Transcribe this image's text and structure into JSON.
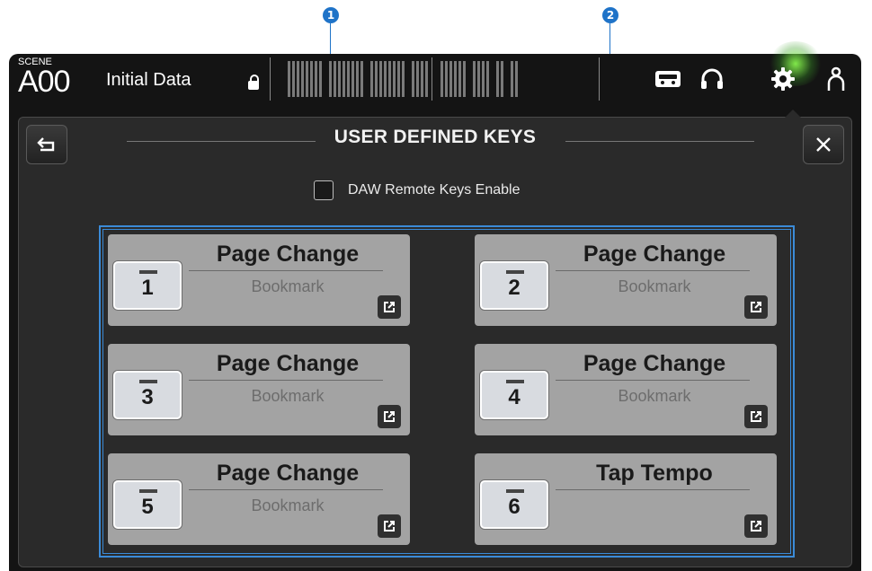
{
  "callouts": [
    "1",
    "2"
  ],
  "topbar": {
    "scene_label": "SCENE",
    "scene_number": "A00",
    "scene_name": "Initial Data",
    "icons": [
      "lock-icon",
      "recorder-icon",
      "headphones-icon",
      "gear-icon",
      "user-icon"
    ]
  },
  "panel": {
    "title": "USER DEFINED KEYS",
    "back_icon": "return-arrow-icon",
    "close_icon": "close-icon",
    "daw_checkbox": {
      "label": "DAW Remote Keys Enable",
      "checked": false
    }
  },
  "keys": [
    {
      "number": "1",
      "function": "Page Change",
      "parameter": "Bookmark"
    },
    {
      "number": "2",
      "function": "Page Change",
      "parameter": "Bookmark"
    },
    {
      "number": "3",
      "function": "Page Change",
      "parameter": "Bookmark"
    },
    {
      "number": "4",
      "function": "Page Change",
      "parameter": "Bookmark"
    },
    {
      "number": "5",
      "function": "Page Change",
      "parameter": "Bookmark"
    },
    {
      "number": "6",
      "function": "Tap Tempo",
      "parameter": ""
    }
  ],
  "colors": {
    "accent": "#1f73c8",
    "highlight_frame": "#3b8bd8",
    "key_bg": "#a3a3a3",
    "gear_glow": "#8cff50"
  }
}
